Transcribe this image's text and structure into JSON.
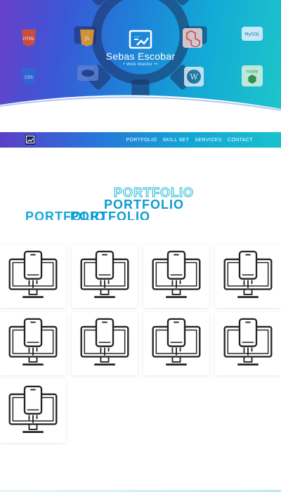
{
  "hero": {
    "brand_name": "Sebas Escobar",
    "brand_tagline": "• Web Master ••",
    "tiles": [
      {
        "label": "HTML",
        "icon": "html5-icon"
      },
      {
        "label": "JS",
        "icon": "javascript-icon"
      },
      {
        "label": "",
        "icon": "laravel-icon"
      },
      {
        "label": "MySQL",
        "icon": "mysql-icon"
      },
      {
        "label": "CSS",
        "icon": "css3-icon"
      },
      {
        "label": "",
        "icon": "php-icon"
      },
      {
        "label": "",
        "icon": "wordpress-icon"
      },
      {
        "label": "node",
        "icon": "nodejs-icon"
      }
    ]
  },
  "nav": {
    "links": [
      "PORTFOLIO",
      "SKILL SET",
      "SERVICES",
      "CONTACT"
    ]
  },
  "portfolio": {
    "heading_outline": "PORTFOLIO",
    "heading_main": "PORTFOLIO",
    "heading_third": "PORTFOLIO",
    "heading_clipped": "PORTFOLIO",
    "item_icon": "responsive-devices-icon",
    "item_count": 9
  },
  "colors": {
    "accent": "#0e9bd0",
    "gradient_start": "#6a3fc9",
    "gradient_end": "#1ec6c9"
  }
}
